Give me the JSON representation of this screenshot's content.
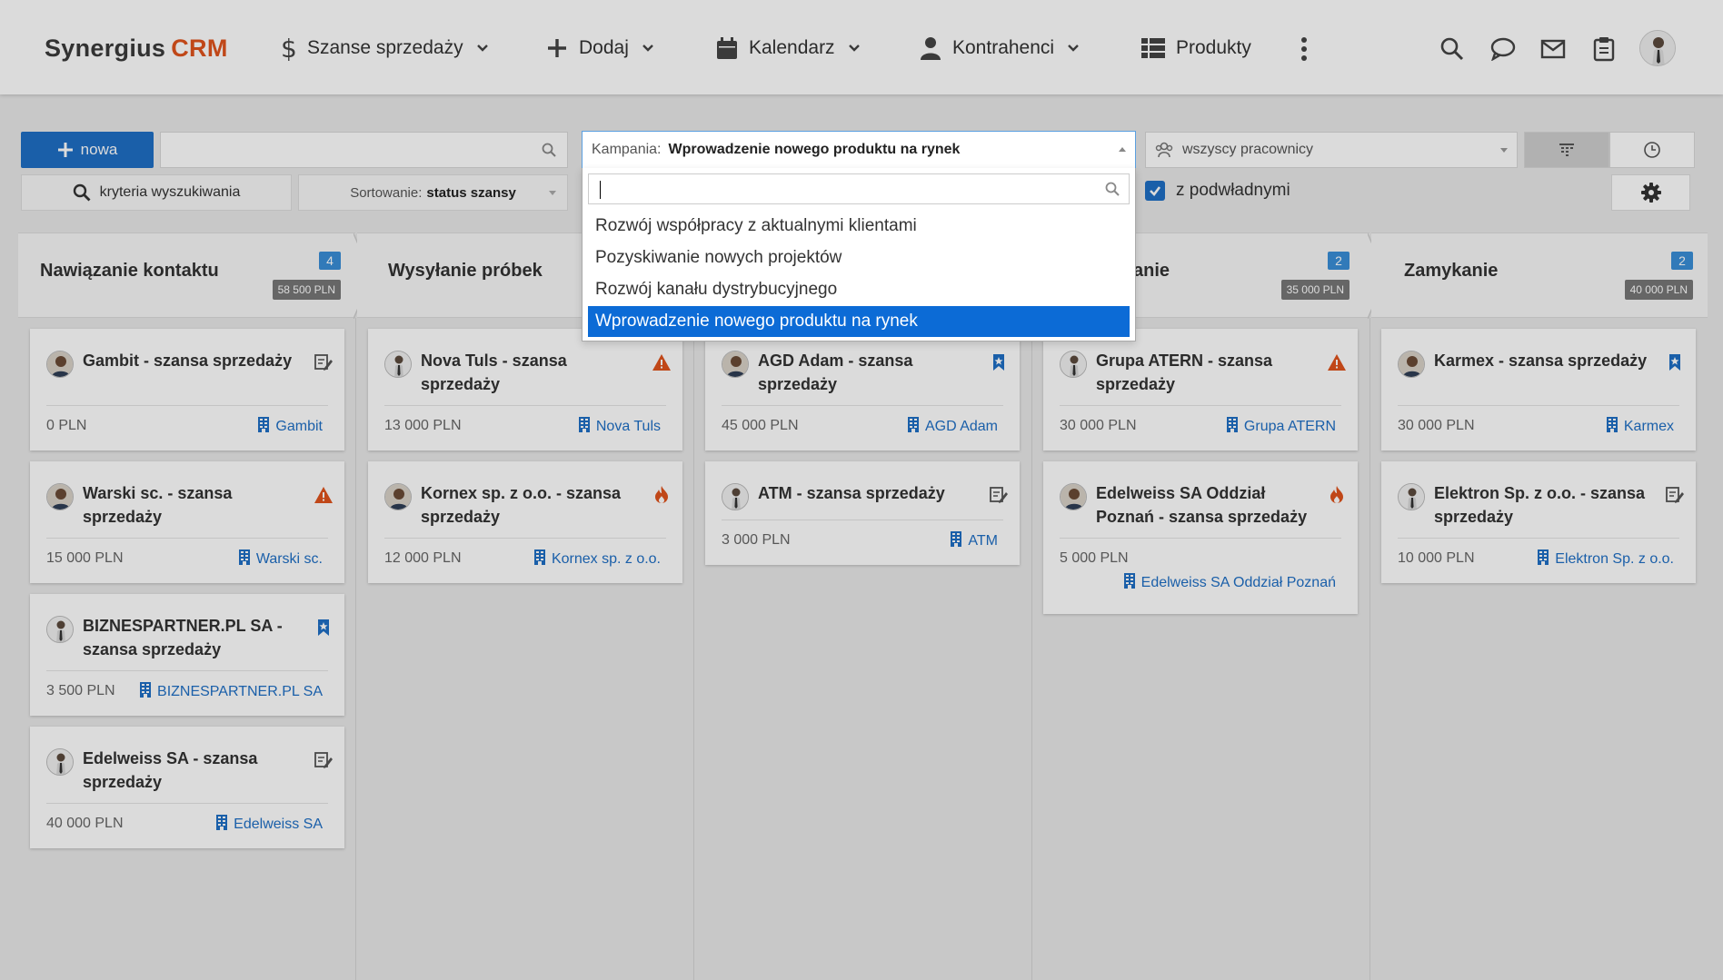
{
  "logo": {
    "part1": "Synergius",
    "part2": "CRM"
  },
  "nav": {
    "sales": "Szanse sprzedaży",
    "add": "Dodaj",
    "calendar": "Kalendarz",
    "contractors": "Kontrahenci",
    "products": "Produkty"
  },
  "toolbar": {
    "new_label": "nowa",
    "search_value": "",
    "criteria_label": "kryteria wyszukiwania",
    "sort_prefix": "Sortowanie:",
    "sort_value": "status szansy",
    "campaign_prefix": "Kampania:",
    "campaign_value": "Wprowadzenie nowego produktu na rynek",
    "workers_label": "wszyscy pracownicy",
    "subordinates_label": "z podwładnymi"
  },
  "dropdown": {
    "search_value": "",
    "options": [
      "Rozwój współpracy z aktualnymi klientami",
      "Pozyskiwanie nowych projektów",
      "Rozwój kanału dystrybucyjnego",
      "Wprowadzenie nowego produktu na rynek"
    ],
    "selected_index": 3
  },
  "colors": {
    "accent": "#1f6fc5",
    "brand": "#e0531c",
    "warn": "#e0531c"
  },
  "stages": [
    {
      "title": "Nawiązanie kontaktu",
      "count": "4",
      "sum": "58 500 PLN"
    },
    {
      "title": "Wysyłanie próbek",
      "count": "",
      "sum": ""
    },
    {
      "title": "",
      "count": "",
      "sum": ""
    },
    {
      "title": "anie",
      "count": "2",
      "sum": "35 000 PLN"
    },
    {
      "title": "Zamykanie",
      "count": "2",
      "sum": "40 000 PLN"
    }
  ],
  "cards": {
    "c0": [
      {
        "title": "Gambit - szansa sprzedaży",
        "amount": "0 PLN",
        "client": "Gambit",
        "flag": "edit-icon"
      },
      {
        "title": "Warski sc. - szansa sprzedaży",
        "amount": "15 000 PLN",
        "client": "Warski sc.",
        "flag": "warning-icon"
      },
      {
        "title": "BIZNESPARTNER.PL SA - szansa sprzedaży",
        "amount": "3 500 PLN",
        "client": "BIZNESPARTNER.PL SA",
        "flag": "bookmark-icon"
      },
      {
        "title": "Edelweiss SA - szansa sprzedaży",
        "amount": "40 000 PLN",
        "client": "Edelweiss SA",
        "flag": "edit-icon"
      }
    ],
    "c1": [
      {
        "title": "Nova Tuls - szansa sprzedaży",
        "amount": "13 000 PLN",
        "client": "Nova Tuls",
        "flag": "warning-icon"
      },
      {
        "title": "Kornex sp. z o.o. - szansa sprzedaży",
        "amount": "12 000 PLN",
        "client": "Kornex sp. z o.o.",
        "flag": "fire-icon"
      }
    ],
    "c2": [
      {
        "title": "AGD Adam - szansa sprzedaży",
        "amount": "45 000 PLN",
        "client": "AGD Adam",
        "flag": "bookmark-icon"
      },
      {
        "title": "ATM - szansa sprzedaży",
        "amount": "3 000 PLN",
        "client": "ATM",
        "flag": "edit-icon"
      }
    ],
    "c3": [
      {
        "title": "Grupa ATERN - szansa sprzedaży",
        "amount": "30 000 PLN",
        "client": "Grupa ATERN",
        "flag": "warning-icon"
      },
      {
        "title": "Edelweiss SA Oddział Poznań - szansa sprzedaży",
        "amount": "5 000 PLN",
        "client": "Edelweiss SA Oddział Poznań",
        "flag": "fire-icon"
      }
    ],
    "c4": [
      {
        "title": "Karmex - szansa sprzedaży",
        "amount": "30 000 PLN",
        "client": "Karmex",
        "flag": "bookmark-icon"
      },
      {
        "title": "Elektron Sp. z o.o. - szansa sprzedaży",
        "amount": "10 000 PLN",
        "client": "Elektron Sp. z o.o.",
        "flag": "edit-icon"
      }
    ]
  }
}
